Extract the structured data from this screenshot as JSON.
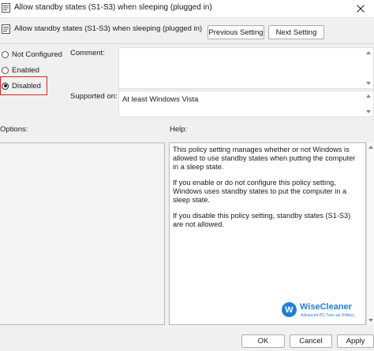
{
  "window": {
    "title": "Allow standby states (S1-S3) when sleeping (plugged in)",
    "icons": [
      "policy-icon",
      "close-icon"
    ]
  },
  "header": {
    "setting_name": "Allow standby states (S1-S3) when sleeping (plugged in)",
    "previous_label": "Previous Setting",
    "next_label": "Next Setting"
  },
  "state": {
    "options": [
      {
        "label": "Not Configured",
        "selected": false
      },
      {
        "label": "Enabled",
        "selected": false
      },
      {
        "label": "Disabled",
        "selected": true
      }
    ],
    "highlight_color": "#d9232a"
  },
  "comment": {
    "label": "Comment:",
    "value": ""
  },
  "supported": {
    "label": "Supported on:",
    "value": "At least Windows Vista"
  },
  "options_section": {
    "label": "Options:"
  },
  "help_section": {
    "label": "Help:",
    "paragraphs": [
      "This policy setting manages whether or not Windows is allowed to use standby states when putting the computer in a sleep state.",
      "If you enable or do not configure this policy setting, Windows uses standby states to put the computer in a sleep state.",
      "If you disable this policy setting, standby states (S1-S3) are not allowed."
    ]
  },
  "watermark": {
    "logo_letter": "W",
    "name": "WiseCleaner",
    "tagline": "Advanced PC Tune-up Utilities",
    "color": "#1e7fd8"
  },
  "footer": {
    "ok_label": "OK",
    "cancel_label": "Cancel",
    "apply_label": "Apply"
  }
}
